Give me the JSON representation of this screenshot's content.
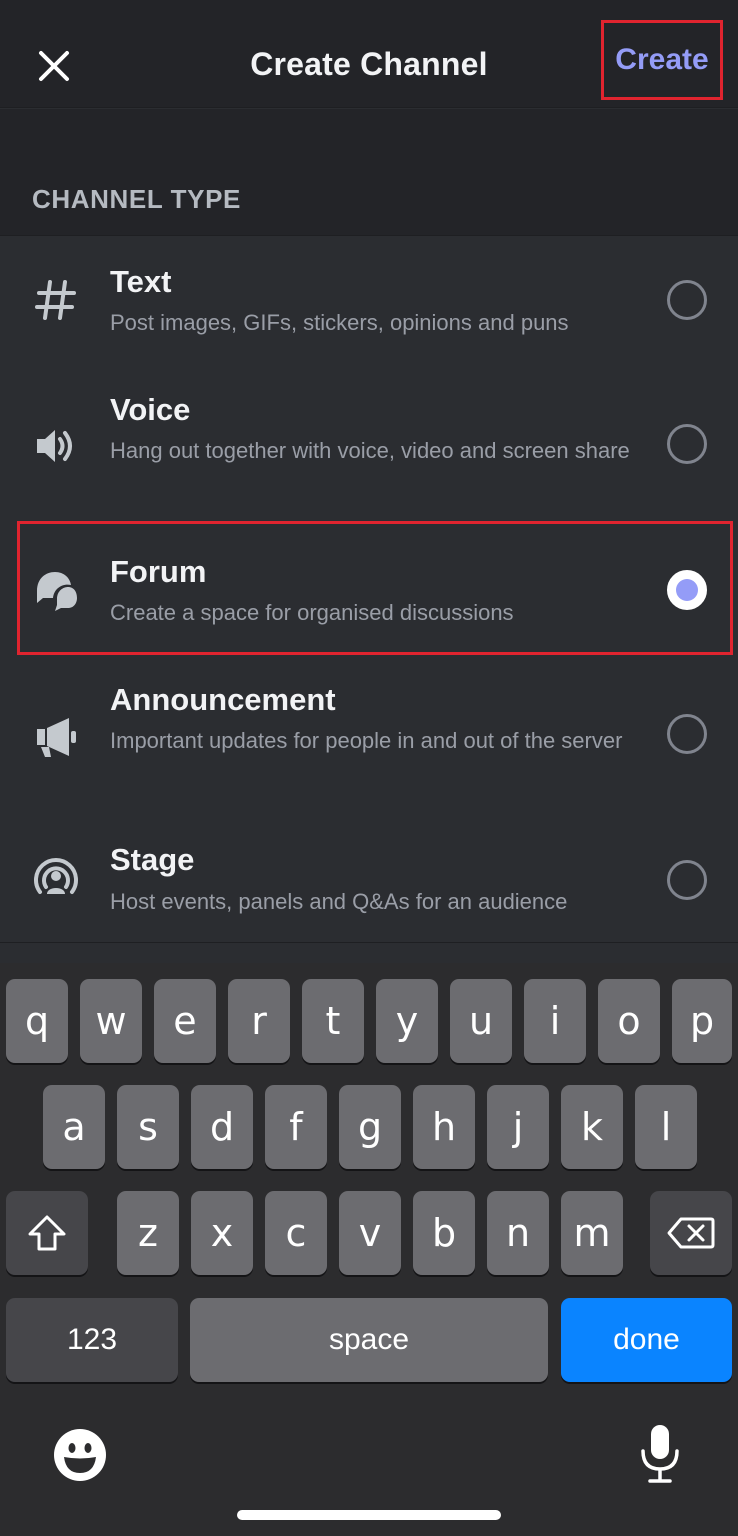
{
  "header": {
    "title": "Create Channel",
    "create_label": "Create"
  },
  "section_label": "CHANNEL TYPE",
  "channel_types": [
    {
      "title": "Text",
      "description": "Post images, GIFs, stickers, opinions and puns",
      "selected": false
    },
    {
      "title": "Voice",
      "description": "Hang out together with voice, video and screen share",
      "selected": false
    },
    {
      "title": "Forum",
      "description": "Create a space for organised discussions",
      "selected": true
    },
    {
      "title": "Announcement",
      "description": "Important updates for people in and out of the server",
      "selected": false
    },
    {
      "title": "Stage",
      "description": "Host events, panels and Q&As for an audience",
      "selected": false
    }
  ],
  "keyboard": {
    "row1": [
      "q",
      "w",
      "e",
      "r",
      "t",
      "y",
      "u",
      "i",
      "o",
      "p"
    ],
    "row2": [
      "a",
      "s",
      "d",
      "f",
      "g",
      "h",
      "j",
      "k",
      "l"
    ],
    "row3": [
      "z",
      "x",
      "c",
      "v",
      "b",
      "n",
      "m"
    ],
    "numbers_label": "123",
    "space_label": "space",
    "done_label": "done"
  },
  "colors": {
    "accent": "#949cf7",
    "highlight_border": "#e0242f",
    "done_key": "#0a84ff"
  }
}
